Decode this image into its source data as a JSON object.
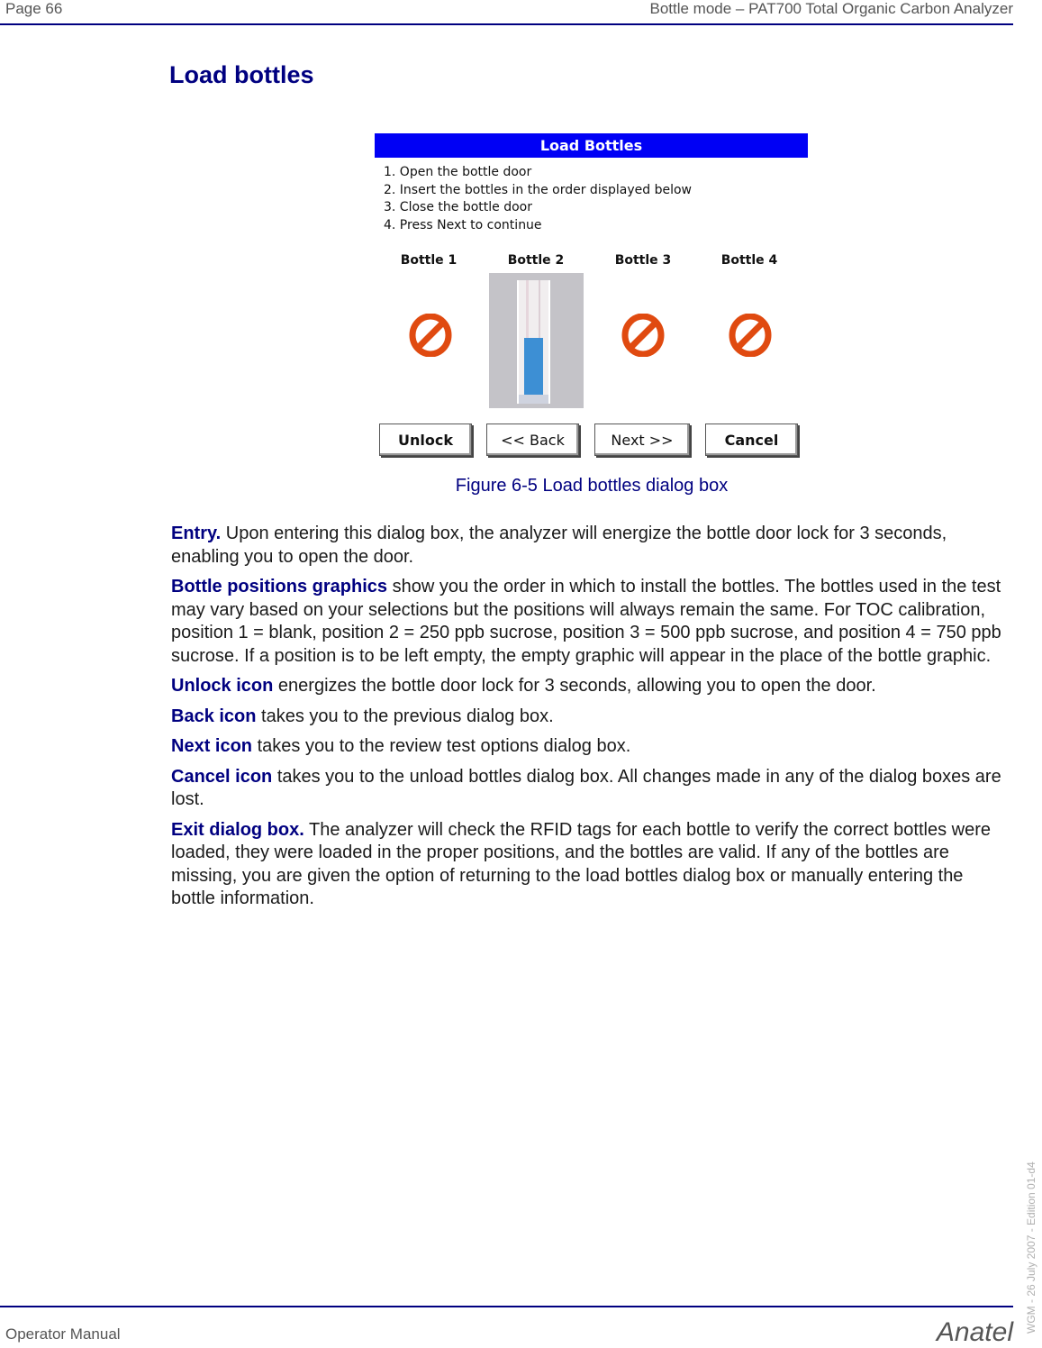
{
  "header": {
    "page_label": "Page 66",
    "section_title": "Bottle mode – PAT700 Total Organic Carbon Analyzer"
  },
  "page_title": "Load bottles",
  "dialog": {
    "title": "Load Bottles",
    "steps": [
      "1. Open the bottle door",
      "2. Insert the bottles in the order displayed below",
      "3. Close the bottle door",
      "4. Press Next to continue"
    ],
    "bottles": [
      {
        "label": "Bottle 1",
        "state": "empty",
        "icon": "no-entry-icon"
      },
      {
        "label": "Bottle 2",
        "state": "loaded",
        "icon": "bottle-graphic"
      },
      {
        "label": "Bottle 3",
        "state": "empty",
        "icon": "no-entry-icon"
      },
      {
        "label": "Bottle 4",
        "state": "empty",
        "icon": "no-entry-icon"
      }
    ],
    "buttons": {
      "unlock": "Unlock",
      "back": "<< Back",
      "next": "Next >>",
      "cancel": "Cancel"
    },
    "colors": {
      "title_bar": "#0000f5",
      "no_entry": "#e04a10",
      "liquid": "#3d8fd4"
    }
  },
  "caption": "Figure 6-5 Load bottles dialog box",
  "paragraphs": [
    {
      "term": "Entry.",
      "text": " Upon entering this dialog box, the analyzer will energize the bottle door lock for 3 seconds, enabling you to open the door."
    },
    {
      "term": "Bottle positions graphics",
      "text": " show you the order in which to install the bottles. The bottles used in the test may vary based on your selections but the positions will always remain the same. For TOC calibration, position 1 = blank, position 2 = 250 ppb sucrose, position 3 = 500 ppb sucrose, and position 4 = 750 ppb sucrose. If a position is to be left empty, the empty graphic will appear in the place of the bottle graphic."
    },
    {
      "term": "Unlock icon",
      "text": " energizes the bottle door lock for 3 seconds, allowing you to open the door."
    },
    {
      "term": "Back icon",
      "text": " takes you to the previous dialog box."
    },
    {
      "term": "Next icon",
      "text": " takes you to the review test options dialog box."
    },
    {
      "term": "Cancel icon",
      "text": " takes you to the unload bottles dialog box. All changes made in any of the dialog boxes are lost."
    },
    {
      "term": "Exit dialog box.",
      "text": " The analyzer will check the RFID tags for each bottle to verify the correct bottles were loaded, they were loaded in the proper positions, and the bottles are valid. If any of the bottles are missing, you are given the option of returning to the load bottles dialog box or manually entering the bottle information."
    }
  ],
  "side_note": "WGM - 26 July 2007 - Edition 01-d4",
  "footer": {
    "left": "Operator Manual",
    "brand": "Anatel"
  }
}
